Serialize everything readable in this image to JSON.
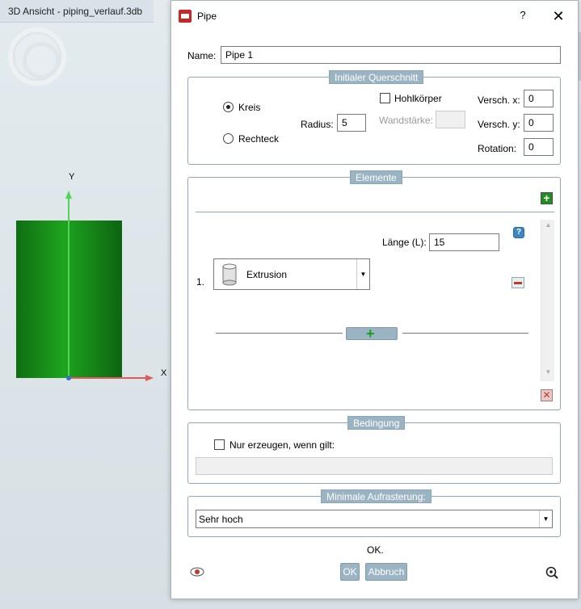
{
  "background_view": {
    "tab_title": "3D Ansicht - piping_verlauf.3db",
    "axis_y_label": "Y",
    "axis_x_label": "X",
    "cylinder_color": "#1c8c1c"
  },
  "dialog": {
    "title": "Pipe",
    "help_label": "?",
    "close_label": "✕",
    "name_label": "Name:",
    "name_value": "Pipe 1"
  },
  "cross_section": {
    "title": "Initialer Querschnitt",
    "kreis_label": "Kreis",
    "rechteck_label": "Rechteck",
    "selected": "Kreis",
    "radius_label": "Radius:",
    "radius_value": "5",
    "hohlkoerper_label": "Hohlkörper",
    "wandstaerke_label": "Wandstärke:",
    "wandstaerke_value": "",
    "versch_x_label": "Versch. x:",
    "versch_x_value": "0",
    "versch_y_label": "Versch. y:",
    "versch_y_value": "0",
    "rotation_label": "Rotation:",
    "rotation_value": "0"
  },
  "elements": {
    "title": "Elemente",
    "items": [
      {
        "index": "1.",
        "type": "Extrusion",
        "laenge_label": "Länge (L):",
        "laenge_value": "15"
      }
    ]
  },
  "condition": {
    "title": "Bedingung",
    "checkbox_label": "Nur erzeugen, wenn gilt:",
    "expression": ""
  },
  "rasterization": {
    "title": "Minimale Aufrasterung:",
    "selected": "Sehr hoch"
  },
  "footer": {
    "status": "OK.",
    "ok_label": "OK",
    "cancel_label": "Abbruch"
  }
}
